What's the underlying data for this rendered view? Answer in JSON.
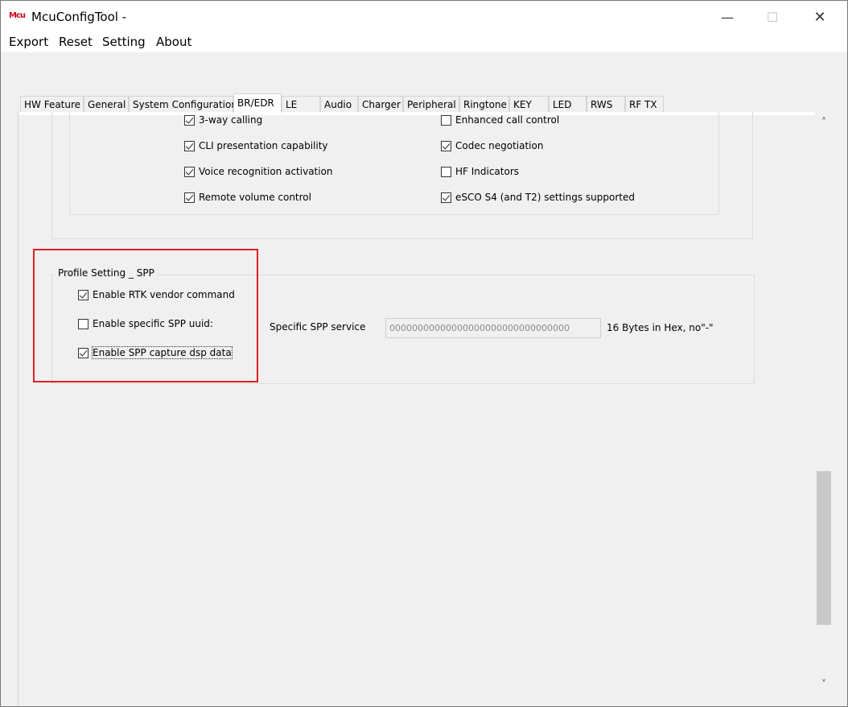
{
  "window": {
    "icon_text": "Mcu",
    "title": "McuConfigTool -",
    "minimize_glyph": "—",
    "maximize_glyph": "☐",
    "close_glyph": "✕"
  },
  "menu": [
    "Export",
    "Reset",
    "Setting",
    "About"
  ],
  "tabs": [
    "HW Feature",
    "General",
    "System Configuration",
    "BR/EDR",
    "LE",
    "Audio",
    "Charger",
    "Peripheral",
    "Ringtone",
    "KEY",
    "LED",
    "RWS",
    "RF TX"
  ],
  "active_tab": "BR/EDR",
  "hfp_features": {
    "left": [
      {
        "label": "3-way calling",
        "checked": true
      },
      {
        "label": "CLI presentation capability",
        "checked": true
      },
      {
        "label": "Voice recognition activation",
        "checked": true
      },
      {
        "label": "Remote volume control",
        "checked": true
      }
    ],
    "right": [
      {
        "label": "Enhanced call control",
        "checked": false
      },
      {
        "label": "Codec negotiation",
        "checked": true
      },
      {
        "label": "HF Indicators",
        "checked": false
      },
      {
        "label": "eSCO S4 (and T2) settings supported",
        "checked": true
      }
    ]
  },
  "spp": {
    "group_title": "Profile Setting _ SPP",
    "options": [
      {
        "label": "Enable RTK vendor command",
        "checked": true
      },
      {
        "label": "Enable specific SPP uuid:",
        "checked": false
      },
      {
        "label": "Enable SPP capture dsp data",
        "checked": true
      }
    ],
    "service_label": "Specific SPP service",
    "service_value": "00000000000000000000000000000000",
    "service_hint": "16 Bytes in Hex, no\"-\""
  },
  "scrollbar": {
    "up_glyph": "˄",
    "down_glyph": "˅"
  },
  "colors": {
    "highlight": "#e02020",
    "background": "#f0f0f0"
  }
}
